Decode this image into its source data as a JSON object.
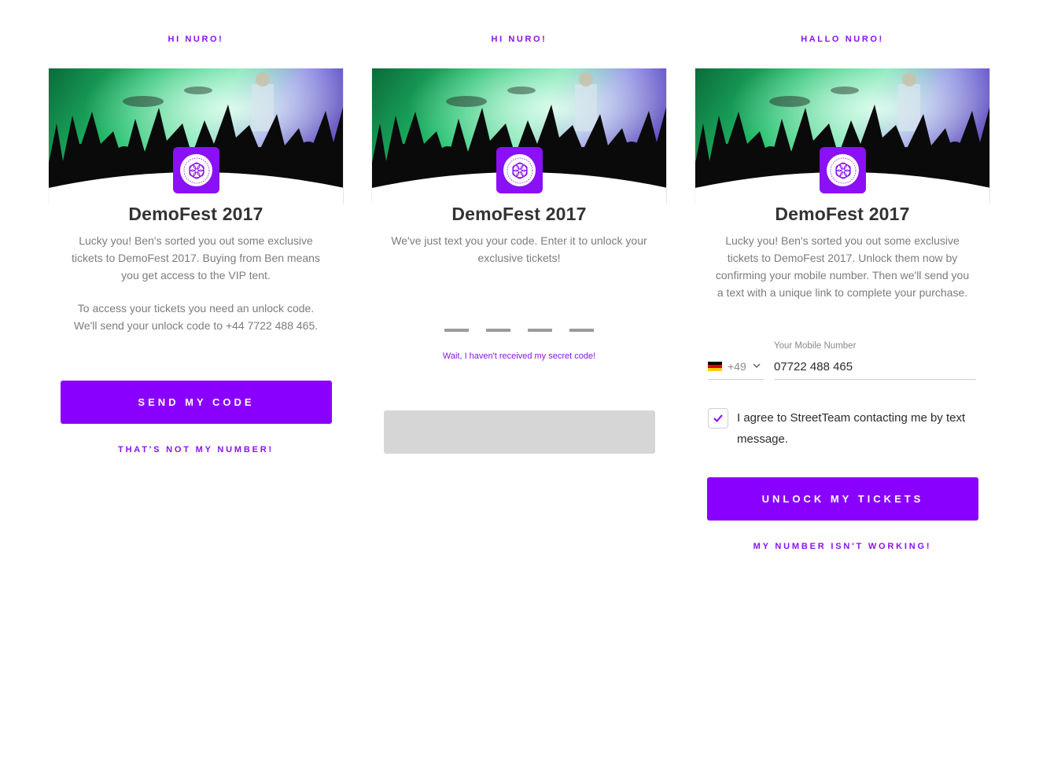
{
  "colors": {
    "accent": "#8a00ff",
    "disabled": "#d6d6d6",
    "muted_text": "#7c7c7c"
  },
  "panels": [
    {
      "greeting": "HI NURO!",
      "title": "DemoFest 2017",
      "paragraph1": "Lucky you! Ben's sorted you out some exclusive tickets to DemoFest 2017. Buying from Ben means you get access to the VIP tent.",
      "paragraph2": "To access your tickets you need an unlock code. We'll send your unlock code to +44 7722 488 465.",
      "button": "SEND MY CODE",
      "link": "THAT'S NOT MY NUMBER!"
    },
    {
      "greeting": "HI NURO!",
      "title": "DemoFest 2017",
      "paragraph1": "We've just text you your code. Enter it to unlock your exclusive tickets!",
      "link": "Wait, I haven't received my secret code!",
      "button": ""
    },
    {
      "greeting": "HALLO NURO!",
      "title": "DemoFest 2017",
      "paragraph1": "Lucky you! Ben's sorted you out some exclusive tickets to DemoFest 2017. Unlock them now by confirming your mobile number. Then we'll send you a text with a unique link to complete your purchase.",
      "country_code": "+49",
      "phone_label": "Your Mobile Number",
      "phone_value": "07722 488 465",
      "consent": "I agree to StreetTeam contacting me by text message.",
      "consent_checked": true,
      "button": "UNLOCK MY TICKETS",
      "link": "MY NUMBER ISN'T WORKING!"
    }
  ]
}
